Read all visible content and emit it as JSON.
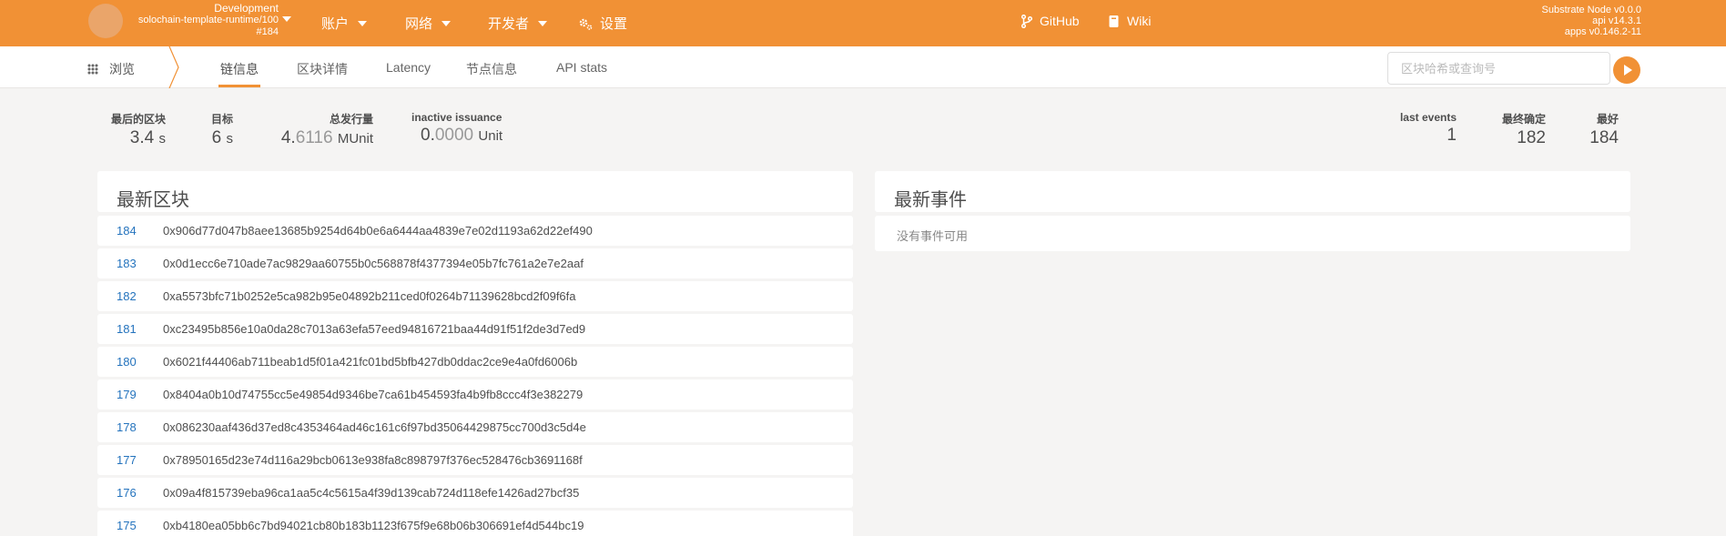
{
  "topbar": {
    "chain_env": "Development",
    "chain_runtime": "solochain-template-runtime/100",
    "chain_block": "#184",
    "menus": [
      "账户",
      "网络",
      "开发者"
    ],
    "settings": "设置",
    "github": "GitHub",
    "wiki": "Wiki",
    "node_version": "Substrate Node v0.0.0",
    "api_version": "api v14.3.1",
    "apps_version": "apps v0.146.2-11"
  },
  "subbar": {
    "browse": "浏览",
    "tabs": [
      "链信息",
      "区块详情",
      "Latency",
      "节点信息",
      "API stats"
    ],
    "search_placeholder": "区块哈希或查询号"
  },
  "summary": {
    "last_block": {
      "label": "最后的区块",
      "value": "3.4",
      "unit": "s"
    },
    "target": {
      "label": "目标",
      "value": "6",
      "unit": "s"
    },
    "total_issuance": {
      "label": "总发行量",
      "value_main": "4.",
      "value_dim": "6116",
      "unit": "MUnit"
    },
    "inactive_issuance": {
      "label": "inactive issuance",
      "value_main": "0.",
      "value_dim": "0000",
      "unit": "Unit"
    },
    "last_events": {
      "label": "last events",
      "value": "1"
    },
    "finalized": {
      "label": "最终确定",
      "value": "182"
    },
    "best": {
      "label": "最好",
      "value": "184"
    }
  },
  "blocks": {
    "title": "最新区块",
    "rows": [
      {
        "number": "184",
        "hash": "0x906d77d047b8aee13685b9254d64b0e6a6444aa4839e7e02d1193a62d22ef490"
      },
      {
        "number": "183",
        "hash": "0x0d1ecc6e710ade7ac9829aa60755b0c568878f4377394e05b7fc761a2e7e2aaf"
      },
      {
        "number": "182",
        "hash": "0xa5573bfc71b0252e5ca982b95e04892b211ced0f0264b71139628bcd2f09f6fa"
      },
      {
        "number": "181",
        "hash": "0xc23495b856e10a0da28c7013a63efa57eed94816721baa44d91f51f2de3d7ed9"
      },
      {
        "number": "180",
        "hash": "0x6021f44406ab711beab1d5f01a421fc01bd5bfb427db0ddac2ce9e4a0fd6006b"
      },
      {
        "number": "179",
        "hash": "0x8404a0b10d74755cc5e49854d9346be7ca61b454593fa4b9fb8ccc4f3e382279"
      },
      {
        "number": "178",
        "hash": "0x086230aaf436d37ed8c4353464ad46c161c6f97bd35064429875cc700d3c5d4e"
      },
      {
        "number": "177",
        "hash": "0x78950165d23e74d116a29bcb0613e938fa8c898797f376ec528476cb3691168f"
      },
      {
        "number": "176",
        "hash": "0x09a4f815739eba96ca1aa5c4c5615a4f39d139cab724d118efe1426ad27bcf35"
      },
      {
        "number": "175",
        "hash": "0xb4180ea05bb6c7bd94021cb80b183b1123f675f9e68b06b306691ef4d544bc19"
      }
    ]
  },
  "events": {
    "title": "最新事件",
    "empty": "没有事件可用"
  },
  "colors": {
    "accent": "#f19135",
    "link": "#2473bd"
  }
}
